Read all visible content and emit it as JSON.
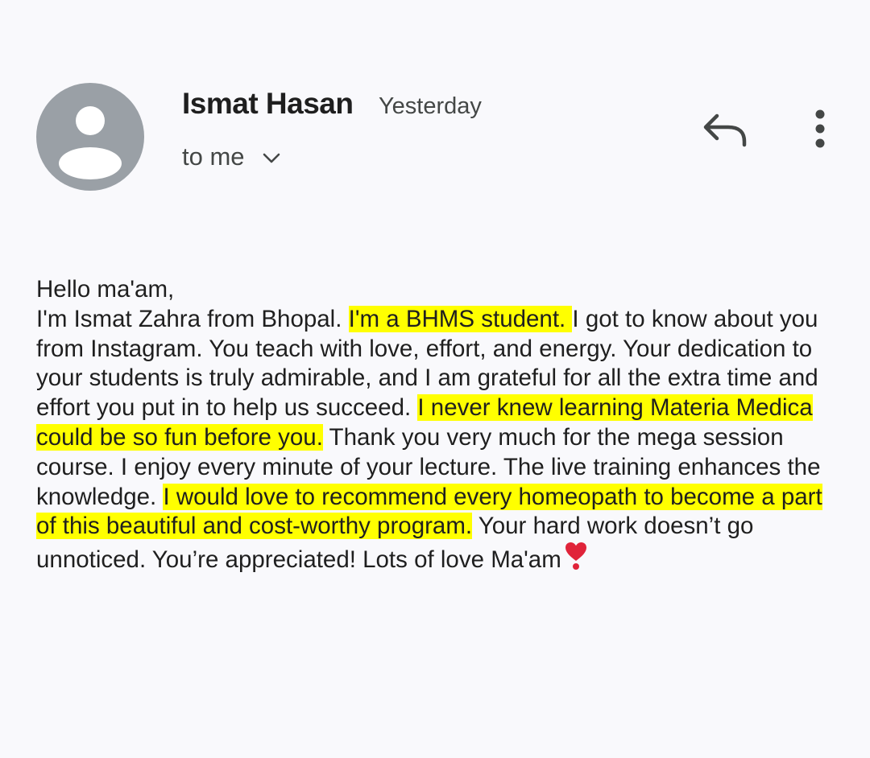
{
  "sender": {
    "name": "Ismat Hasan",
    "time": "Yesterday",
    "recipient": "to me"
  },
  "icons": {
    "avatar": "person-avatar-icon",
    "details": "chevron-down-icon",
    "reply": "reply-arrow-icon",
    "more": "more-vert-icon",
    "heart": "heart-exclamation-emoji"
  },
  "colors": {
    "background": "#f9f9fc",
    "avatar": "#9aa0a6",
    "highlight": "#ffff00",
    "heart": "#e0243a"
  },
  "message": {
    "greeting": "Hello ma'am,",
    "segments": [
      "I'm Ismat Zahra from Bhopal. ",
      "I'm a BHMS student. ",
      "I got to know about you from Instagram. You teach with love, effort, and energy. Your dedication to your students is truly admirable, and I am grateful for all the extra time and effort you put in to help us succeed. ",
      "I never knew learning Materia Medica could be so fun before you.",
      " Thank you very much for the mega session course. I enjoy every minute of your lecture. The live training enhances the knowledge. ",
      "I would love to recommend every homeopath to become a part of this beautiful and cost-worthy program.",
      " Your hard work doesn’t go unnoticed. You’re appreciated! Lots of love Ma'am"
    ]
  }
}
